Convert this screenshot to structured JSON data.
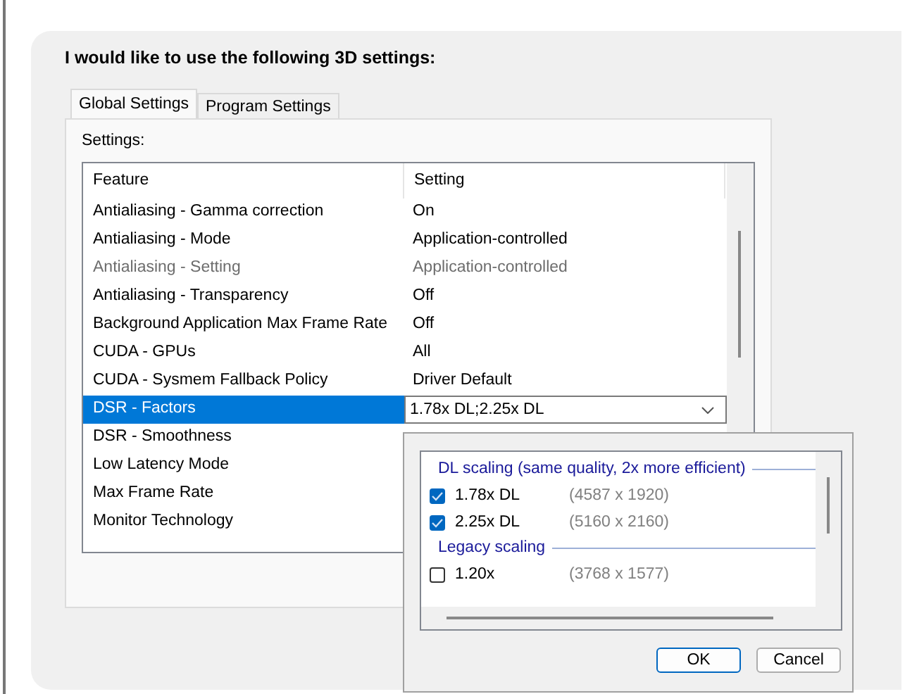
{
  "heading": "I would like to use the following 3D settings:",
  "tabs": [
    {
      "label": "Global Settings",
      "selected": true
    },
    {
      "label": "Program Settings",
      "selected": false
    }
  ],
  "settings_label": "Settings:",
  "table": {
    "columns": [
      "Feature",
      "Setting"
    ],
    "rows": [
      {
        "feature": "Antialiasing - Gamma correction",
        "setting": "On",
        "disabled": false,
        "selected": false
      },
      {
        "feature": "Antialiasing - Mode",
        "setting": "Application-controlled",
        "disabled": false,
        "selected": false
      },
      {
        "feature": "Antialiasing - Setting",
        "setting": "Application-controlled",
        "disabled": true,
        "selected": false
      },
      {
        "feature": "Antialiasing - Transparency",
        "setting": "Off",
        "disabled": false,
        "selected": false
      },
      {
        "feature": "Background Application Max Frame Rate",
        "setting": "Off",
        "disabled": false,
        "selected": false
      },
      {
        "feature": "CUDA - GPUs",
        "setting": "All",
        "disabled": false,
        "selected": false
      },
      {
        "feature": "CUDA - Sysmem Fallback Policy",
        "setting": "Driver Default",
        "disabled": false,
        "selected": false
      },
      {
        "feature": "DSR - Factors",
        "setting": "1.78x DL;2.25x DL",
        "disabled": false,
        "selected": true
      },
      {
        "feature": "DSR - Smoothness",
        "setting": "",
        "disabled": false,
        "selected": false
      },
      {
        "feature": "Low Latency Mode",
        "setting": "",
        "disabled": false,
        "selected": false
      },
      {
        "feature": "Max Frame Rate",
        "setting": "",
        "disabled": false,
        "selected": false
      },
      {
        "feature": "Monitor Technology",
        "setting": "",
        "disabled": false,
        "selected": false
      }
    ]
  },
  "dropdown": {
    "groups": [
      {
        "title": "DL scaling (same quality, 2x more efficient)",
        "options": [
          {
            "label": "1.78x DL",
            "resolution": "(4587 x 1920)",
            "checked": true
          },
          {
            "label": "2.25x DL",
            "resolution": "(5160 x 2160)",
            "checked": true
          }
        ]
      },
      {
        "title": "Legacy scaling",
        "options": [
          {
            "label": "1.20x",
            "resolution": "(3768 x 1577)",
            "checked": false
          }
        ]
      }
    ],
    "buttons": [
      {
        "label": "OK",
        "kind": "default"
      },
      {
        "label": "Cancel",
        "kind": "normal"
      }
    ]
  }
}
